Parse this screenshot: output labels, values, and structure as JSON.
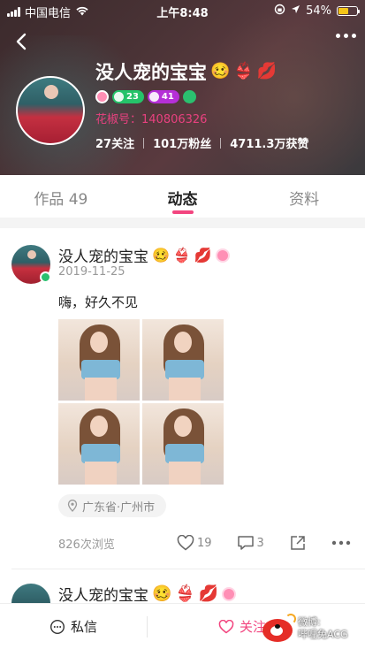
{
  "status_bar": {
    "carrier": "中国电信",
    "time": "上午8:48",
    "battery": "54%",
    "battery_level": 0.54
  },
  "profile": {
    "name": "没人宠的宝宝",
    "name_emojis": [
      "🥴",
      "👙",
      "💋"
    ],
    "level_badge_1": "23",
    "level_badge_2": "41",
    "huajiao_id": "花椒号：140806326",
    "stats": {
      "following": "27关注",
      "fans": "101万粉丝",
      "likes": "4711.3万获赞"
    },
    "colors": {
      "accent": "#f2457f",
      "green_pill": "#25c36a",
      "purple_pill": "#b52fd7"
    }
  },
  "tabs": [
    {
      "label": "作品 49"
    },
    {
      "label": "动态"
    },
    {
      "label": "资料"
    }
  ],
  "active_tab": "动态",
  "post": {
    "author": "没人宠的宝宝",
    "date": "2019-11-25",
    "text": "嗨，好久不见",
    "location": "广东省·广州市",
    "views": "826次浏览",
    "likes": "19",
    "comments": "3",
    "icons": [
      "location-pin-icon",
      "heart-icon",
      "comment-icon",
      "share-icon",
      "more-icon"
    ]
  },
  "post2": {
    "author": "没人宠的宝宝"
  },
  "bottom_bar": {
    "message_label": "私信",
    "follow_label": "关注"
  },
  "watermark": {
    "line1": "微博:",
    "line2": "哔哩免ACG"
  }
}
